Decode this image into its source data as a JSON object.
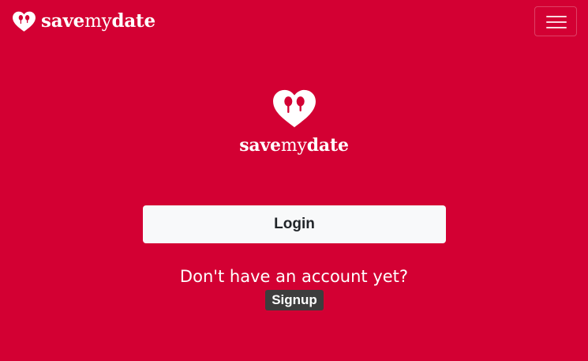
{
  "brand": {
    "name_part1": "save",
    "name_part2": "my",
    "name_part3": "date",
    "logo_icon": "heart-logo-icon"
  },
  "navbar": {
    "toggler_icon": "hamburger-menu-icon"
  },
  "hero": {
    "logo_icon": "heart-logo-icon",
    "name_part1": "save",
    "name_part2": "my",
    "name_part3": "date"
  },
  "auth": {
    "login_label": "Login",
    "prompt_text": "Don't have an account yet?",
    "signup_label": "Signup"
  },
  "colors": {
    "background": "#d30033",
    "login_button_bg": "#f8f9fa",
    "login_button_text": "#212529",
    "signup_button_bg": "#3d3d3d",
    "text": "#ffffff"
  }
}
